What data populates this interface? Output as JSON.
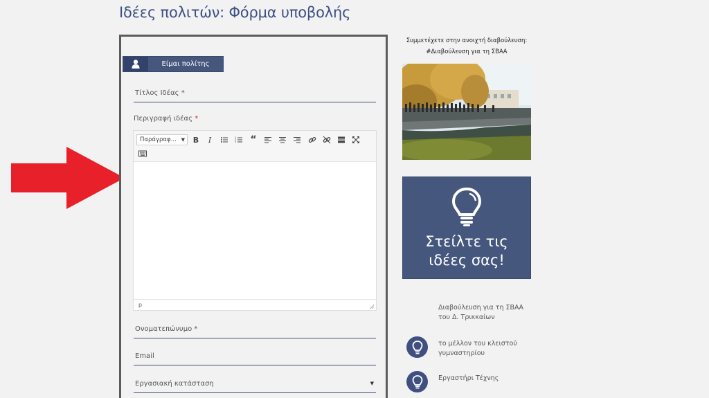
{
  "page": {
    "title": "Ιδέες πολιτών: Φόρμα υποβολής"
  },
  "form": {
    "role_tab": "Είμαι πολίτης",
    "idea_title_label": "Τίτλος Ιδέας *",
    "description_label": "Περιγραφή ιδέας",
    "required_mark": "*",
    "editor": {
      "format_select": "Παράγραφ...",
      "status_path": "p",
      "content": ""
    },
    "fullname_label": "Ονοματεπώνυμο *",
    "email_label": "Email",
    "work_status_label": "Εργασιακή κατάσταση"
  },
  "sidebar": {
    "promo_line1": "Συμμετέχετε στην ανοιχτή διαβούλευση:",
    "promo_line2": "#Διαβούλευση για τη ΣΒΑΑ",
    "cta_line1": "Στείλτε τις",
    "cta_line2": "ιδέες σας!",
    "consultation_title": "Διαβούλευση για τη ΣΒΑΑ του Δ. Τρικκαίων",
    "ideas": [
      {
        "label": "το μέλλον του κλειστού γυμναστηρίου"
      },
      {
        "label": "Εργαστήρι Τέχνης"
      }
    ]
  },
  "colors": {
    "brand": "#46577e",
    "arrow": "#e8202a"
  }
}
